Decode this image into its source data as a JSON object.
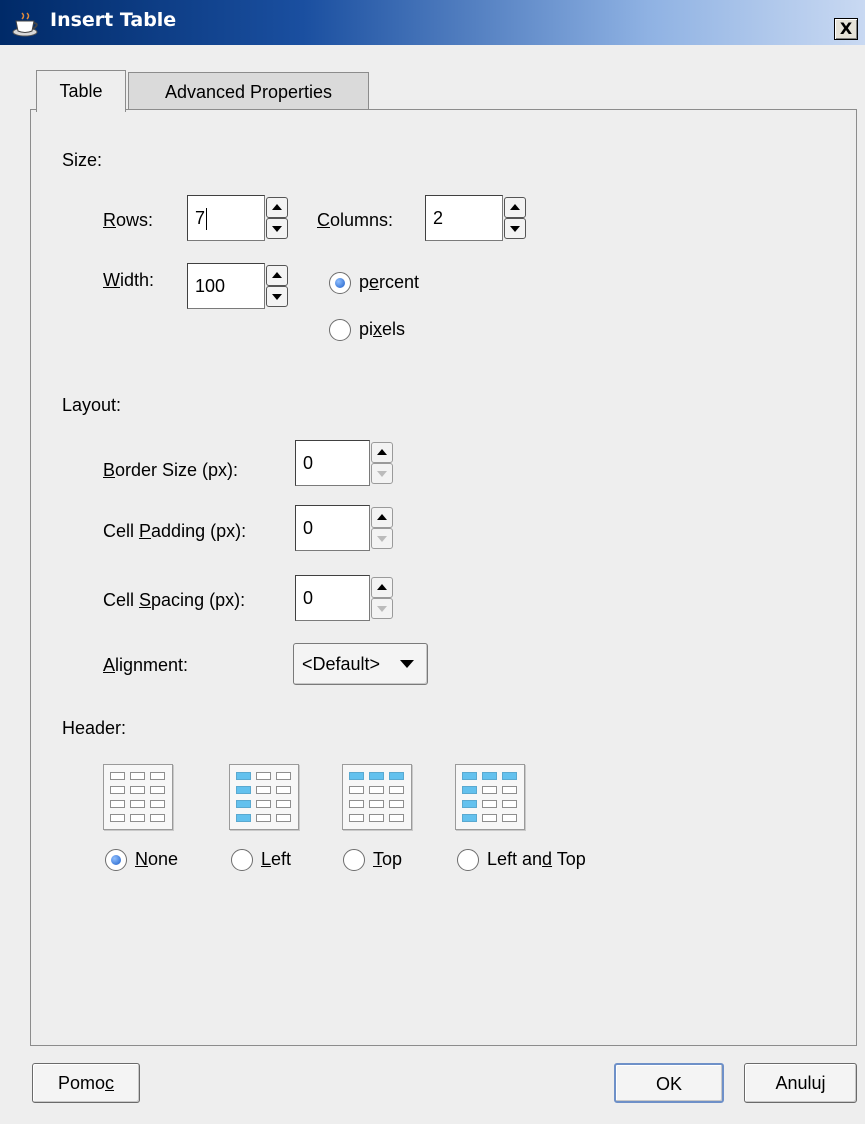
{
  "window": {
    "title": "Insert Table",
    "close_label": "X"
  },
  "tabs": [
    {
      "label": "Table",
      "active": true
    },
    {
      "label": "Advanced Properties",
      "active": false
    }
  ],
  "size": {
    "section_label": "Size:",
    "rows": {
      "prefix": "",
      "accel": "R",
      "rest": "ows:",
      "value": "7"
    },
    "columns": {
      "prefix": "",
      "accel": "C",
      "rest": "olumns:",
      "value": "2"
    },
    "width": {
      "prefix": "",
      "accel": "W",
      "rest": "idth:",
      "value": "100"
    },
    "units": [
      {
        "pre": "p",
        "accel": "e",
        "post": "rcent",
        "selected": true
      },
      {
        "pre": "pi",
        "accel": "x",
        "post": "els",
        "selected": false
      }
    ]
  },
  "layout": {
    "section_label": "Layout:",
    "border": {
      "prefix": "",
      "accel": "B",
      "rest": "order Size (px):",
      "value": "0"
    },
    "padding": {
      "prefix": "Cell ",
      "accel": "P",
      "rest": "adding (px):",
      "value": "0"
    },
    "spacing": {
      "prefix": "Cell ",
      "accel": "S",
      "rest": "pacing (px):",
      "value": "0"
    },
    "alignment": {
      "prefix": "",
      "accel": "A",
      "rest": "lignment:",
      "value": "<Default>"
    }
  },
  "header": {
    "section_label": "Header:",
    "options": [
      {
        "pre": "",
        "accel": "N",
        "post": "one",
        "selected": true,
        "icon": "table-header-none-icon"
      },
      {
        "pre": "",
        "accel": "L",
        "post": "eft",
        "selected": false,
        "icon": "table-header-left-icon"
      },
      {
        "pre": "",
        "accel": "T",
        "post": "op",
        "selected": false,
        "icon": "table-header-top-icon"
      },
      {
        "pre": "Left an",
        "accel": "d",
        "post": " Top",
        "selected": false,
        "icon": "table-header-left-top-icon"
      }
    ]
  },
  "buttons": {
    "help": {
      "pre": "Pomo",
      "accel": "c"
    },
    "ok": "OK",
    "cancel": "Anuluj"
  },
  "colors": {
    "header_cell_highlight": "#63c1ee",
    "title_bar": "#0a3a85"
  }
}
